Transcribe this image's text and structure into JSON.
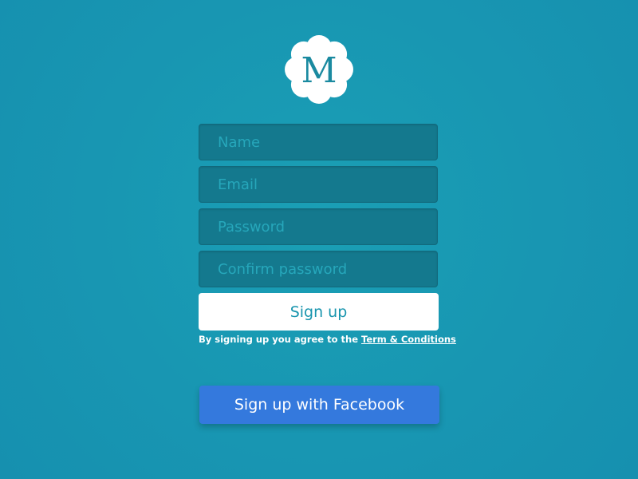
{
  "logo": {
    "letter": "M",
    "icon": "scalloped-badge-icon",
    "letter_color": "#1a8aa0"
  },
  "form": {
    "fields": [
      {
        "name": "name",
        "placeholder": "Name",
        "value": ""
      },
      {
        "name": "email",
        "placeholder": "Email",
        "value": ""
      },
      {
        "name": "password",
        "placeholder": "Password",
        "value": ""
      },
      {
        "name": "confirm_password",
        "placeholder": "Confirm password",
        "value": ""
      }
    ],
    "signup_label": "Sign up",
    "terms_text": "By signing up you agree to the ",
    "terms_link": "Term & Conditions"
  },
  "facebook": {
    "label": "Sign up with Facebook"
  },
  "colors": {
    "background": "#1896b2",
    "field_bg": "#14798e",
    "placeholder": "#26a7bb",
    "signup_button_bg": "#ffffff",
    "signup_button_text": "#1895ae",
    "facebook_button_bg": "#3479dd"
  }
}
